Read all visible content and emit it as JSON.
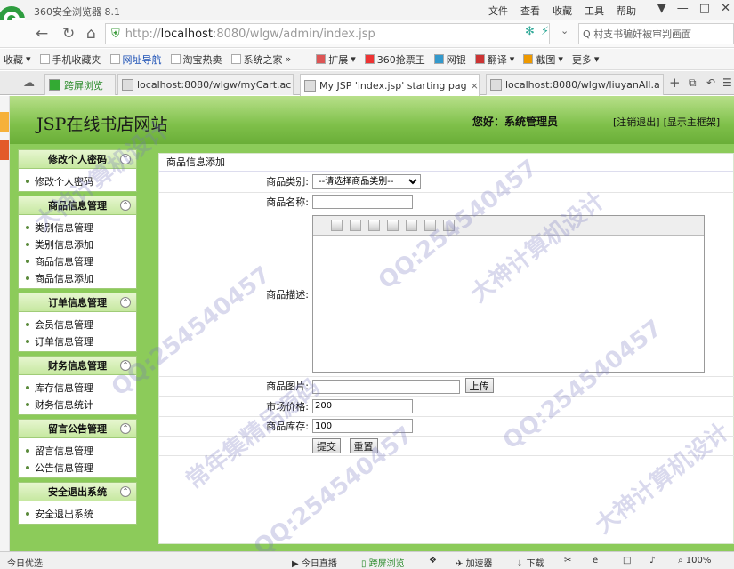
{
  "browser": {
    "title": "360安全浏览器 8.1",
    "top_menu": [
      "文件",
      "查看",
      "收藏",
      "工具",
      "帮助"
    ],
    "url": {
      "scheme": "http://",
      "host": "localhost",
      "path": ":8080/wlgw/admin/index.jsp"
    },
    "search_text": "Q 村支书骗奸被审判画面",
    "bookmarks": [
      "收藏",
      "手机收藏夹",
      "网址导航",
      "淘宝热卖",
      "系统之家",
      "扩展",
      "360抢票王",
      "网银",
      "翻译",
      "截图",
      "更多"
    ],
    "tabs": [
      {
        "label": "跨屏浏览"
      },
      {
        "label": "localhost:8080/wlgw/myCart.ac"
      },
      {
        "label": "My JSP 'index.jsp' starting pag"
      },
      {
        "label": "localhost:8080/wlgw/liuyanAll.a"
      }
    ],
    "status": {
      "left": "今日优选",
      "live": "今日直播",
      "cross": "跨屏浏览",
      "speed": "加速器",
      "download": "下载",
      "zoom": "100%"
    }
  },
  "header": {
    "site_title": "JSP在线书店网站",
    "greeting": "您好：系统管理员",
    "logout": "[注销退出]",
    "show_frame": "[显示主框架]"
  },
  "sidebar": [
    {
      "title": "修改个人密码",
      "items": [
        "修改个人密码"
      ]
    },
    {
      "title": "商品信息管理",
      "items": [
        "类别信息管理",
        "类别信息添加",
        "商品信息管理",
        "商品信息添加"
      ]
    },
    {
      "title": "订单信息管理",
      "items": [
        "会员信息管理",
        "订单信息管理"
      ]
    },
    {
      "title": "财务信息管理",
      "items": [
        "库存信息管理",
        "财务信息统计"
      ]
    },
    {
      "title": "留言公告管理",
      "items": [
        "留言信息管理",
        "公告信息管理"
      ]
    },
    {
      "title": "安全退出系统",
      "items": [
        "安全退出系统"
      ]
    }
  ],
  "form": {
    "title": "商品信息添加",
    "category_label": "商品类别:",
    "category_selected": "--请选择商品类别--",
    "name_label": "商品名称:",
    "name_value": "",
    "desc_label": "商品描述:",
    "image_label": "商品图片:",
    "image_value": "",
    "upload_button": "上传",
    "price_label": "市场价格:",
    "price_value": "200",
    "stock_label": "商品库存:",
    "stock_value": "100",
    "submit_button": "提交",
    "reset_button": "重置"
  },
  "watermarks": [
    "QQ:254540457",
    "大神计算机设计",
    "常年集精品源码"
  ]
}
